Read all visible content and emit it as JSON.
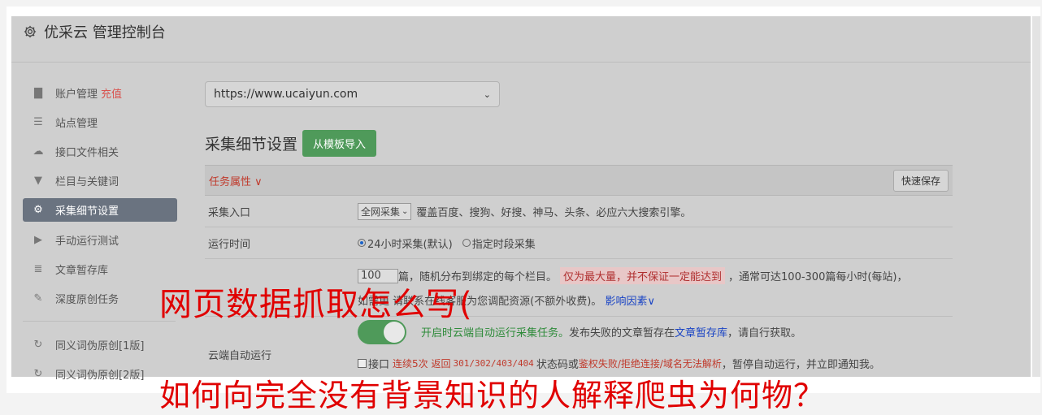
{
  "header": {
    "title": "优采云 管理控制台"
  },
  "sidebar": {
    "items": [
      {
        "label": "账户管理",
        "extra": "充值",
        "icon": "bar-chart-icon"
      },
      {
        "label": "站点管理",
        "icon": "server-icon"
      },
      {
        "label": "接口文件相关",
        "icon": "cloud-upload-icon"
      },
      {
        "label": "栏目与关键词",
        "icon": "filter-icon"
      },
      {
        "label": "采集细节设置",
        "icon": "gears-icon",
        "active": true
      },
      {
        "label": "手动运行测试",
        "icon": "play-circle-icon"
      },
      {
        "label": "文章暂存库",
        "icon": "database-icon"
      },
      {
        "label": "深度原创任务",
        "icon": "edit-icon"
      },
      {
        "label": "同义词伪原创[1版]",
        "icon": "refresh-icon"
      },
      {
        "label": "同义词伪原创[2版]",
        "icon": "refresh-icon"
      }
    ]
  },
  "main": {
    "site_select": "https://www.ucaiyun.com",
    "section_title": "采集细节设置",
    "import_button": "从模板导入",
    "task_label": "任务属性",
    "quick_save": "快速保存",
    "rows": {
      "entry_label": "采集入口",
      "entry_select": "全网采集",
      "entry_desc": "覆盖百度、搜狗、好搜、神马、头条、必应六大搜索引擎。",
      "time_label": "运行时间",
      "time_opt1": "24小时采集(默认)",
      "time_opt2": "指定时段采集",
      "count_value": "100",
      "count_desc1": "篇，随机分布到绑定的每个栏目。",
      "count_pink": "仅为最大量，并不保证一定能达到",
      "count_desc2": "，通常可达100-300篇每小时(每站)，",
      "count_line2a": "如需更",
      "count_line2b": "请联系在线客服为您调配资源(不额外收费)。",
      "count_link": "影响因素",
      "cloud_label": "云端自动运行",
      "cloud_on": "开启时云端自动运行采集任务。",
      "cloud_desc": "发布失败的文章暂存在",
      "cloud_link": "文章暂存库",
      "cloud_desc2": "，请自行获取。",
      "iface_label": "接口",
      "iface_red": "连续5次 返回",
      "iface_codes": "301/302/403/404",
      "iface_mid": "状态码或",
      "iface_red2": "鉴权失败/拒绝连接/域名无法解析",
      "iface_end": "，暂停自动运行，并立即通知我。"
    }
  },
  "overlay": {
    "line1": "网页数据抓取怎么写(",
    "line2": "如何向完全没有背景知识的人解释爬虫为何物？"
  },
  "colors": {
    "accent_green": "#4f9a5a",
    "overlay_red": "#e00000",
    "active_nav": "#6a7380"
  }
}
